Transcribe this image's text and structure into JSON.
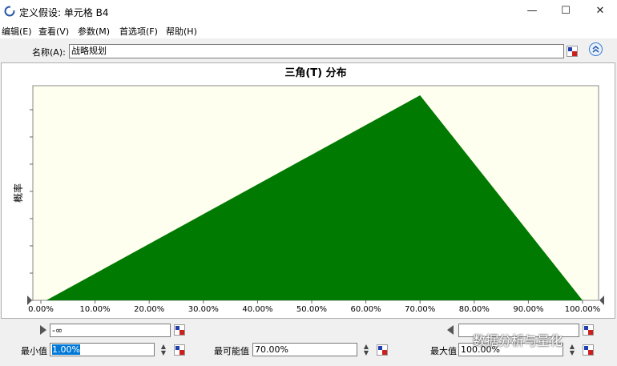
{
  "window": {
    "title": "定义假设: 单元格 B4",
    "minimize": "—",
    "maximize": "☐",
    "close": "✕"
  },
  "menu": [
    "编辑(E)",
    "查看(V)",
    "参数(M)",
    "首选项(F)",
    "帮助(H)"
  ],
  "name_field": {
    "label": "名称(A):",
    "value": "战略规划"
  },
  "chart_data": {
    "type": "area",
    "title": "三角(T) 分布",
    "ylabel": "概率",
    "xlabel": "",
    "x_tick_labels": [
      "0.00%",
      "10.00%",
      "20.00%",
      "30.00%",
      "40.00%",
      "50.00%",
      "60.00%",
      "70.00%",
      "80.00%",
      "90.00%",
      "100.00%"
    ],
    "xlim": [
      0,
      100
    ],
    "x": [
      1,
      70,
      100
    ],
    "y": [
      0,
      1,
      0
    ],
    "fill_color": "#007a00",
    "plot_background": "#fffff0",
    "grid": false
  },
  "bounds": {
    "lower_value": "-∞",
    "upper_value": ""
  },
  "params": {
    "min_label": "最小值",
    "min_value": "1.00%",
    "likely_label": "最可能值",
    "likely_value": "70.00%",
    "max_label": "最大值",
    "max_value": "100.00%"
  },
  "watermark": "数据分析与量化"
}
